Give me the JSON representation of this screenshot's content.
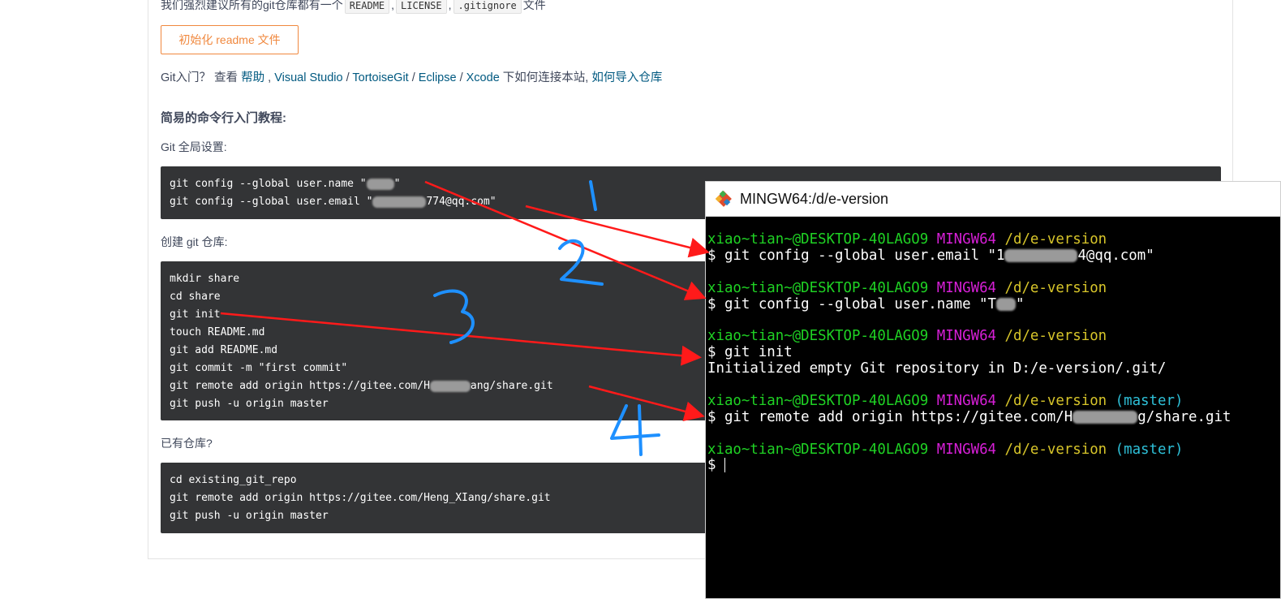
{
  "page": {
    "hint_prefix": "我们强烈建议所有的git仓库都有一个",
    "hint_codes": [
      "README",
      "LICENSE",
      ".gitignore"
    ],
    "hint_suffix": "文件",
    "init_button": "初始化 readme 文件",
    "links": {
      "prefix": "Git入门？ 查看",
      "help": "帮助",
      "vs": "Visual Studio",
      "tortoise": "TortoiseGit",
      "eclipse": "Eclipse",
      "xcode": "Xcode",
      "mid": "下如何连接本站,",
      "import": "如何导入仓库"
    },
    "section_title": "简易的命令行入门教程:",
    "global_label": "Git 全局设置:",
    "global_lines": [
      "git config --global user.name \"",
      "\"",
      "git config --global user.email \"",
      "774@qq.com\""
    ],
    "create_label": "创建 git 仓库:",
    "create_lines": [
      "mkdir share",
      "cd share",
      "git init",
      "touch README.md",
      "git add README.md",
      "git commit -m \"first commit\"",
      "git remote add origin https://gitee.com/H",
      "ang/share.git",
      "git push -u origin master"
    ],
    "existing_label": "已有仓库?",
    "existing_lines": [
      "cd existing_git_repo",
      "git remote add origin https://gitee.com/Heng_XIang/share.git",
      "git push -u origin master"
    ]
  },
  "terminal": {
    "title": "MINGW64:/d/e-version",
    "user": "xiao~tian~@DESKTOP-40LAGO9",
    "env": "MINGW64",
    "path": "/d/e-version",
    "branch": "(master)",
    "cmd1": "$ git config --global user.email \"1",
    "cmd1_end": "4@qq.com\"",
    "cmd2": "$ git config --global user.name \"T",
    "cmd2_end": "\"",
    "cmd3": "$ git init",
    "out3": "Initialized empty Git repository in D:/e-version/.git/",
    "cmd4": "$ git remote add origin https://gitee.com/H",
    "cmd4_end": "g/share.git",
    "prompt": "$ "
  },
  "annotations": [
    "1",
    "2",
    "3",
    "4"
  ],
  "colors": {
    "arrow": "#ff1a1a",
    "number": "#1e90ff",
    "accent": "#f0883e",
    "link": "#005980"
  }
}
